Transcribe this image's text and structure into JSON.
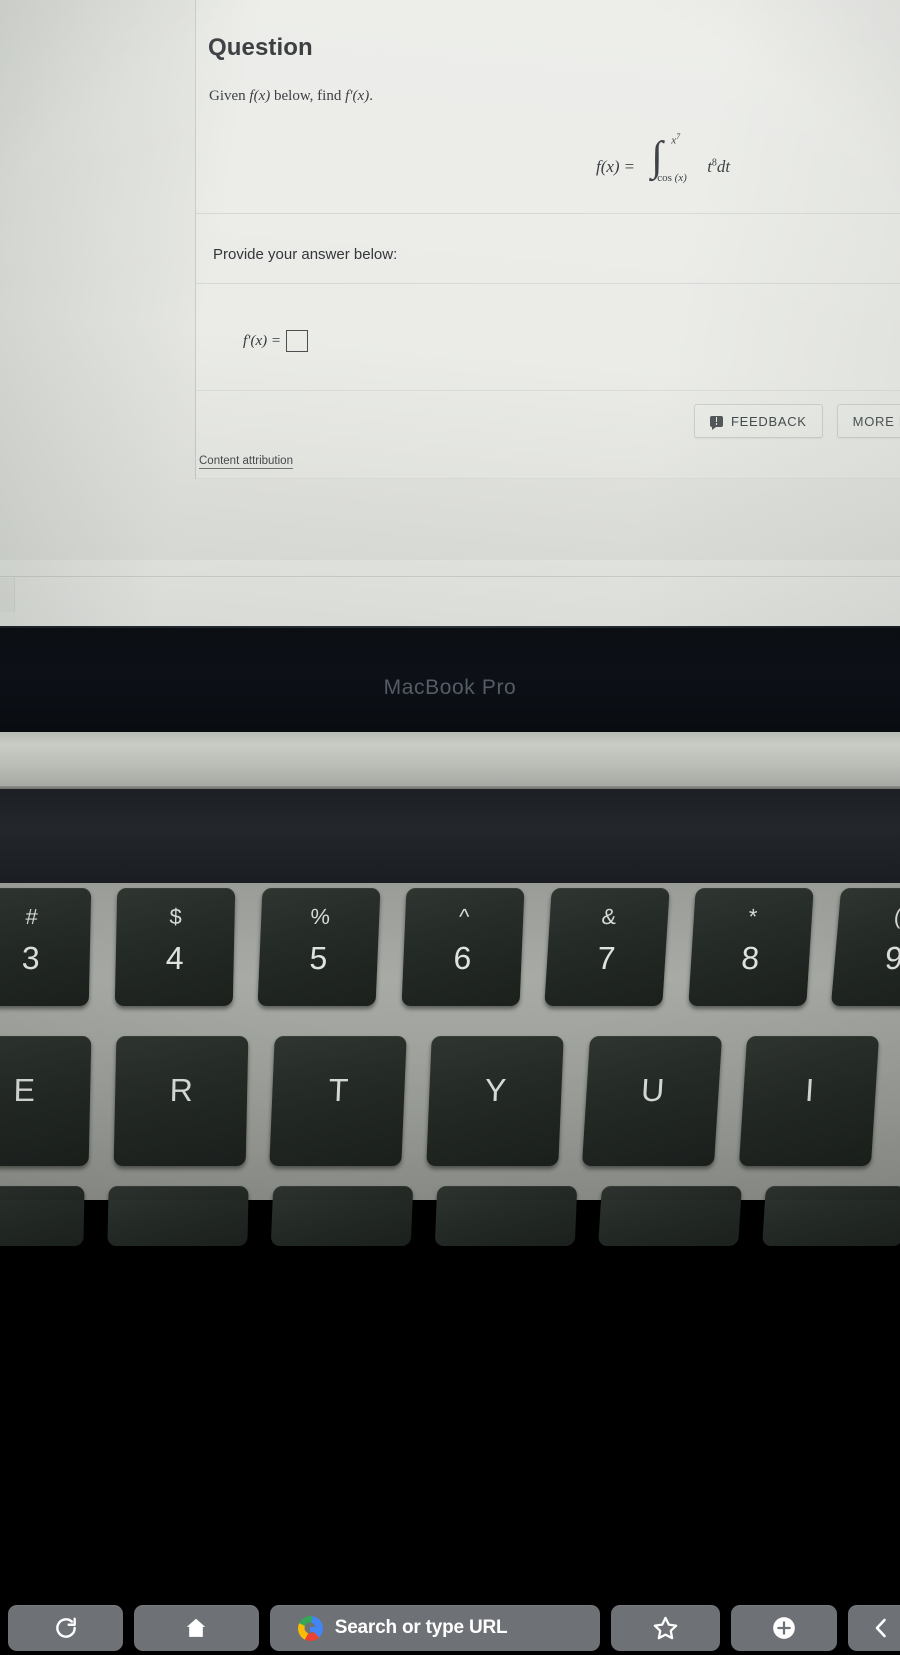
{
  "screen": {
    "card": {
      "title": "Question",
      "prompt_parts": {
        "pre": "Given ",
        "fx": "f(x)",
        "mid": " below, find ",
        "fpx": "f′(x)",
        "post": "."
      },
      "formula": {
        "lhs": "f(x)",
        "equals": "=",
        "integral_sign": "∫",
        "upper_limit": "x",
        "upper_limit_exp": "7",
        "lower_limit_fn": "cos",
        "lower_limit_arg": "(x)",
        "integrand_var": "t",
        "integrand_exp": "8",
        "differential": "dt",
        "plain": "f(x) = ∫_{cos (x)}^{x^7} t^8 dt"
      },
      "provide_answer_label": "Provide your answer below:",
      "answer": {
        "label": "f′(x) =",
        "value": "",
        "placeholder": ""
      },
      "buttons": [
        {
          "label": "FEEDBACK",
          "icon": "feedback-bubble-icon"
        },
        {
          "label": "MORE IN",
          "icon": ""
        }
      ],
      "attribution_link": "Content attribution"
    }
  },
  "laptop": {
    "bezel_brand": "MacBook Pro",
    "touchbar": {
      "items": [
        {
          "name": "reload",
          "icon": "reload-icon",
          "label": ""
        },
        {
          "name": "home",
          "icon": "home-icon",
          "label": ""
        },
        {
          "name": "omnibox",
          "icon": "google-g-icon",
          "label": "Search or type URL"
        },
        {
          "name": "bookmark",
          "icon": "star-icon",
          "label": ""
        },
        {
          "name": "new-tab",
          "icon": "plus-circle-icon",
          "label": ""
        },
        {
          "name": "back",
          "icon": "chevron-left-icon",
          "label": ""
        }
      ]
    },
    "keyboard": {
      "number_row": [
        {
          "symbol": "#",
          "number": "3"
        },
        {
          "symbol": "$",
          "number": "4"
        },
        {
          "symbol": "%",
          "number": "5"
        },
        {
          "symbol": "^",
          "number": "6"
        },
        {
          "symbol": "&",
          "number": "7"
        },
        {
          "symbol": "*",
          "number": "8"
        },
        {
          "symbol": "(",
          "number": "9"
        }
      ],
      "letter_row": [
        {
          "letter": "E"
        },
        {
          "letter": "R"
        },
        {
          "letter": "T"
        },
        {
          "letter": "Y"
        },
        {
          "letter": "U"
        },
        {
          "letter": "I"
        }
      ]
    }
  },
  "colors": {
    "screen_bg": "#e9eae6",
    "card_bg": "#ebece8",
    "text": "#2f3336",
    "bezel": "#0d1117",
    "touchbar_key": "#6e7276",
    "keycap": "#262c28",
    "deck": "#9a9d97",
    "google_red": "#ea4335",
    "google_yellow": "#fbbc05",
    "google_green": "#34a853",
    "google_blue": "#4285f4"
  }
}
